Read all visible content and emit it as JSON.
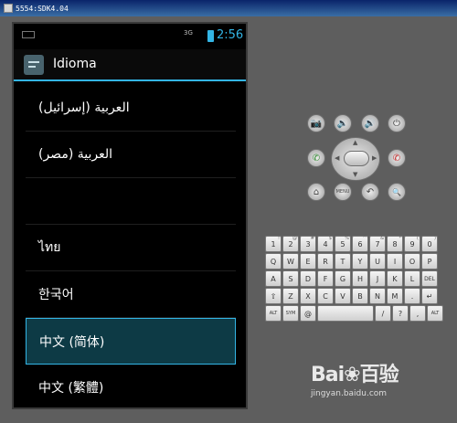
{
  "window": {
    "title": "5554:SDK4.04"
  },
  "statusbar": {
    "signal": "3G",
    "time": "2:56"
  },
  "actionbar": {
    "title": "Idioma"
  },
  "languages": [
    "العربية (إسرائيل)",
    "العربية (مصر)",
    "",
    "ไทย",
    "한국어",
    "中文 (简体)",
    "中文 (繁體)"
  ],
  "selected_index": 5,
  "controls": {
    "camera": "📷",
    "vol_down": "🔉",
    "vol_up": "🔊",
    "power": "⏻",
    "call": "✆",
    "end_call": "✆",
    "home": "⌂",
    "menu": "MENU",
    "back": "↶",
    "search": "🔍"
  },
  "keyboard": {
    "row1": [
      "1",
      "2",
      "3",
      "4",
      "5",
      "6",
      "7",
      "8",
      "9",
      "0"
    ],
    "row1_sup": [
      "!",
      "@",
      "#",
      "$",
      "%",
      "^",
      "&",
      "*",
      "(",
      ")"
    ],
    "row2": [
      "Q",
      "W",
      "E",
      "R",
      "T",
      "Y",
      "U",
      "I",
      "O",
      "P"
    ],
    "row3": [
      "A",
      "S",
      "D",
      "F",
      "G",
      "H",
      "J",
      "K",
      "L",
      "DEL"
    ],
    "row4": [
      "⇧",
      "Z",
      "X",
      "C",
      "V",
      "B",
      "N",
      "M",
      ".",
      "↵"
    ],
    "row5": [
      "ALT",
      "SYM",
      "@",
      "",
      "/",
      "?",
      ",",
      "ALT"
    ]
  },
  "watermark": {
    "logo": "Bai❀百验",
    "sub": "jingyan.baidu.com"
  }
}
